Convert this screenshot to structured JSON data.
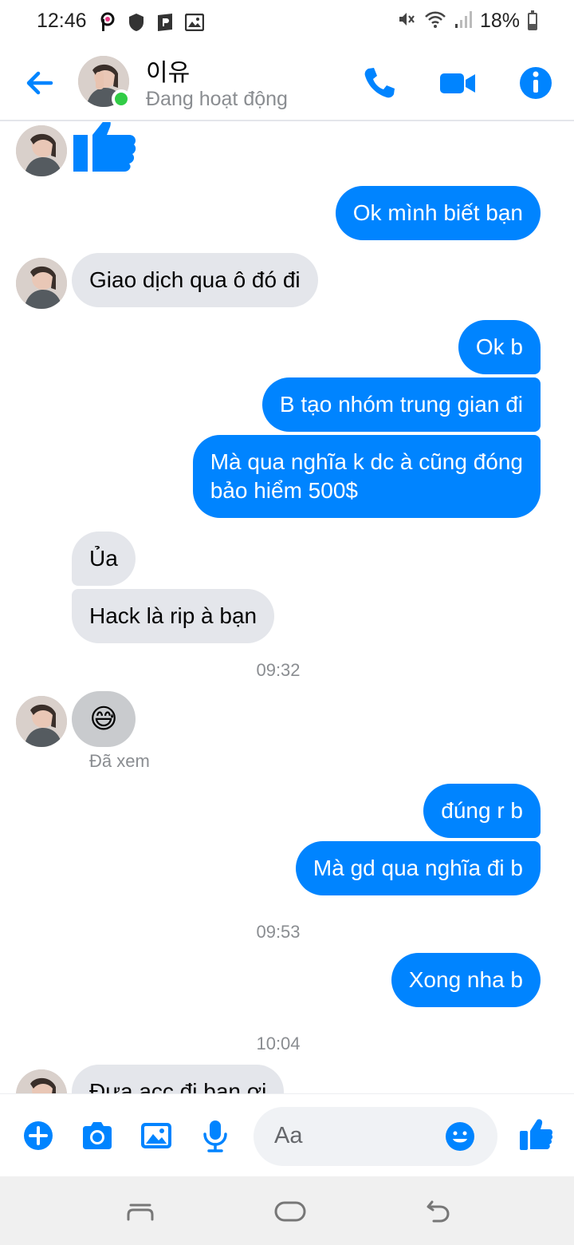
{
  "status_bar": {
    "time": "12:46",
    "battery": "18%",
    "icons": [
      "picsart-icon",
      "shield-icon",
      "parking-icon",
      "image-icon",
      "mute-icon",
      "wifi-icon",
      "signal-icon",
      "battery-icon"
    ]
  },
  "header": {
    "contact_name": "이유",
    "contact_status": "Đang hoạt động",
    "icons": [
      "back-arrow-icon",
      "phone-icon",
      "video-icon",
      "info-icon"
    ],
    "accent_color": "#0084ff"
  },
  "messages": [
    {
      "type": "sticker",
      "from": "them",
      "sticker": "thumbs-up"
    },
    {
      "from": "me",
      "text": "Ok mình biết bạn"
    },
    {
      "from": "them",
      "text": "Giao dịch qua ô đó đi"
    },
    {
      "from": "me",
      "text": "Ok b"
    },
    {
      "from": "me",
      "text": "B tạo nhóm trung gian đi"
    },
    {
      "from": "me",
      "lines": [
        "Mà qua nghĩa k dc à cũng đóng",
        "bảo hiểm 500$"
      ]
    },
    {
      "from": "them",
      "text": "Ủa"
    },
    {
      "from": "them",
      "text": "Hack là rip à bạn"
    },
    {
      "type": "timestamp",
      "text": "09:32"
    },
    {
      "from": "them",
      "type": "emoji",
      "emoji": "😅"
    },
    {
      "type": "seen",
      "text": "Đã xem"
    },
    {
      "from": "me",
      "text": "đúng r b"
    },
    {
      "from": "me",
      "text": "Mà gd qua nghĩa đi b"
    },
    {
      "type": "timestamp",
      "text": "09:53"
    },
    {
      "from": "me",
      "text": "Xong nha b"
    },
    {
      "type": "timestamp",
      "text": "10:04"
    },
    {
      "from": "them",
      "text": "Đưa acc đi bạn ơi"
    }
  ],
  "composer": {
    "placeholder": "Aa",
    "icons": [
      "plus-icon",
      "camera-icon",
      "gallery-icon",
      "microphone-icon",
      "emoji-icon",
      "like-icon"
    ]
  },
  "navbar": {
    "icons": [
      "recent-apps-icon",
      "home-icon",
      "back-icon"
    ]
  }
}
